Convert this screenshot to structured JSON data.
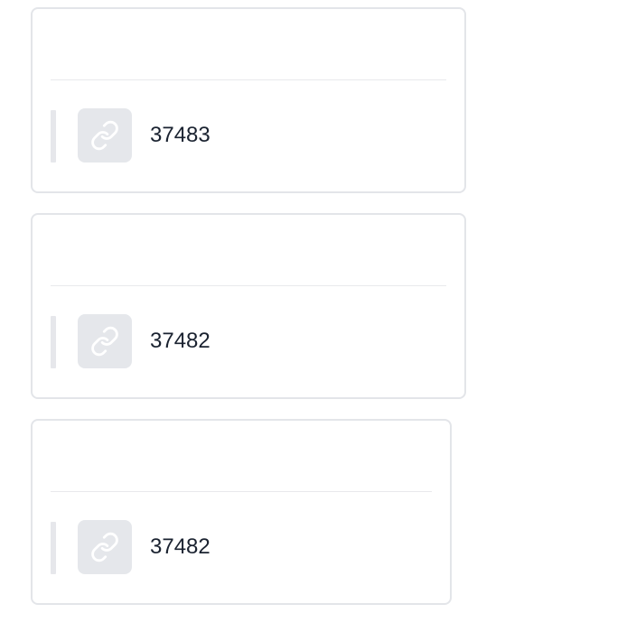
{
  "items": [
    {
      "title": "",
      "count": "37483",
      "icon": "link-icon"
    },
    {
      "title": "",
      "count": "37482",
      "icon": "link-icon"
    },
    {
      "title": "",
      "count": "37482",
      "icon": "link-icon"
    }
  ],
  "colors": {
    "title_link": "#2b57c7",
    "border": "#e3e5e9",
    "tile": "#e5e7eb",
    "count_text": "#1a2230"
  }
}
